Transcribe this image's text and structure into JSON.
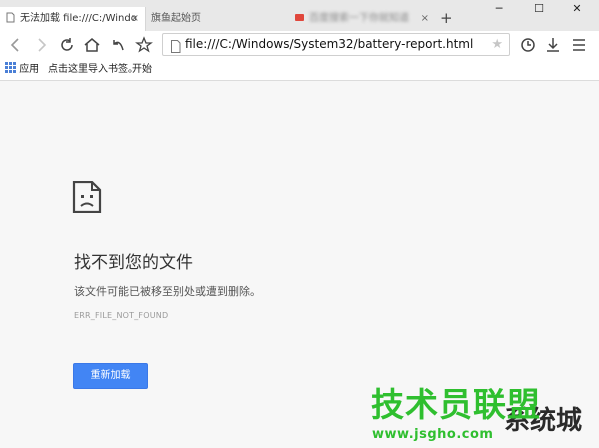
{
  "tabs": [
    {
      "title": "无法加载 file:///C:/Windo",
      "close": "×"
    },
    {
      "title": "旗鱼起始页"
    },
    {
      "title": "百度搜索一下你就知道",
      "close": "×"
    }
  ],
  "newtab": "+",
  "window_controls": {
    "minimize": "─",
    "maximize": "☐",
    "close": "✕"
  },
  "address": {
    "url": "file:///C:/Windows/System32/battery-report.html",
    "star": "★"
  },
  "bookmarks": {
    "apps_label": "应用",
    "import_label": "点击这里导入书签。",
    "start_label": "开始"
  },
  "error": {
    "title": "找不到您的文件",
    "description": "该文件可能已被移至别处或遭到删除。",
    "code": "ERR_FILE_NOT_FOUND",
    "reload_label": "重新加载"
  },
  "watermark": {
    "text": "技术员联盟",
    "url": "www.jsgho.com",
    "bg_text": "系统城"
  },
  "colors": {
    "accent": "#4285f4",
    "watermark": "#2fbf2f"
  }
}
